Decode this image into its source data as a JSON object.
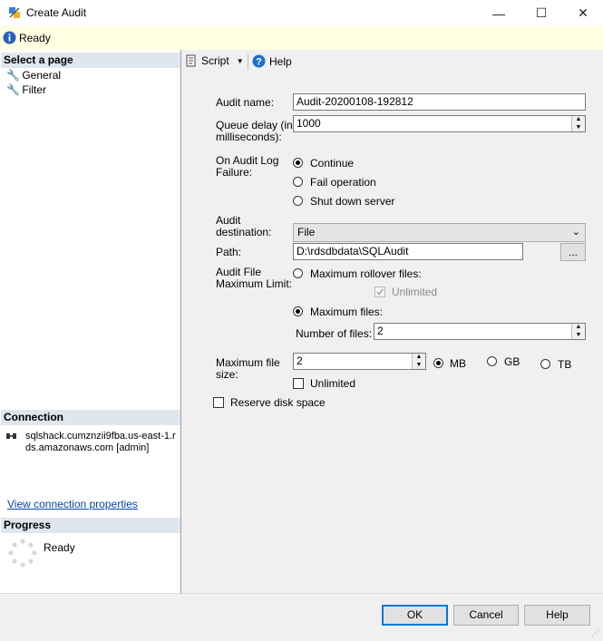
{
  "window": {
    "title": "Create Audit",
    "minimize": "—",
    "maximize": "☐",
    "close": "✕"
  },
  "status": {
    "text": "Ready"
  },
  "left": {
    "select_page": "Select a page",
    "pages": [
      "General",
      "Filter"
    ],
    "connection_head": "Connection",
    "connection_text_line1": "sqlshack.cumznzii9fba.us-east-1.r",
    "connection_text_line2": "ds.amazonaws.com [admin]",
    "view_connection": "View connection properties",
    "progress_head": "Progress",
    "progress_text": "Ready"
  },
  "toolbar": {
    "script": "Script",
    "help": "Help"
  },
  "form": {
    "audit_name_label": "Audit name:",
    "audit_name_value": "Audit-20200108-192812",
    "queue_delay_label_1": "Queue delay (in",
    "queue_delay_label_2": "milliseconds):",
    "queue_delay_value": "1000",
    "failure_label_1": "On Audit Log",
    "failure_label_2": "Failure:",
    "failure_options": [
      "Continue",
      "Fail operation",
      "Shut down server"
    ],
    "failure_selected": 0,
    "destination_label_1": "Audit",
    "destination_label_2": "destination:",
    "destination_value": "File",
    "path_label": "Path:",
    "path_value": "D:\\rdsdbdata\\SQLAudit",
    "browse_label": "...",
    "limit_label_1": "Audit File",
    "limit_label_2": "Maximum Limit:",
    "max_rollover_label": "Maximum rollover files:",
    "unlimited_rollover_label": "Unlimited",
    "max_files_label": "Maximum files:",
    "number_files_label": "Number of files:",
    "number_files_value": "2",
    "max_size_label_1": "Maximum file",
    "max_size_label_2": "size:",
    "max_size_value": "2",
    "units": [
      "MB",
      "GB",
      "TB"
    ],
    "unit_selected": 0,
    "unlimited_size_label": "Unlimited",
    "reserve_label": "Reserve disk space"
  },
  "buttons": {
    "ok": "OK",
    "cancel": "Cancel",
    "help": "Help"
  }
}
